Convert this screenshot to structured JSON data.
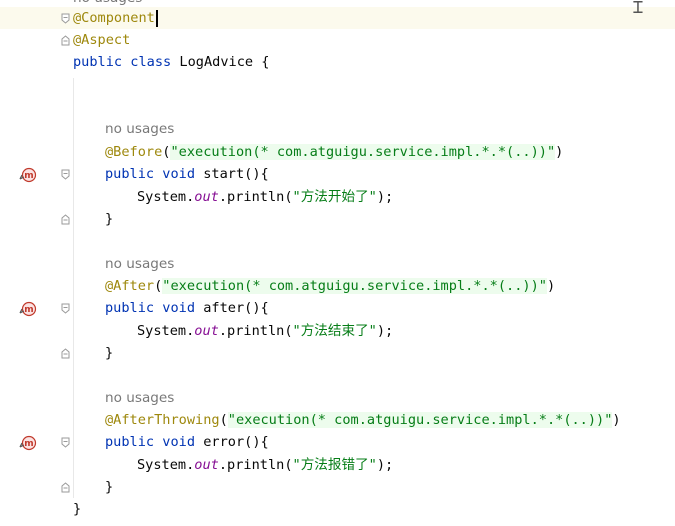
{
  "editor": {
    "top_hint": "no usages",
    "annotation_component": "@Component",
    "annotation_aspect": "@Aspect",
    "class_decl": {
      "keyword_public": "public",
      "keyword_class": "class",
      "name": "LogAdvice",
      "open_brace": " {"
    },
    "methods": [
      {
        "hint": "no usages",
        "annotation": "@Before",
        "pointcut": "\"execution(* com.atguigu.service.impl.*.*(..))\"",
        "signature_keywords": "public void",
        "signature_rest": " start(){",
        "body_prefix": "System.",
        "body_field": "out",
        "body_call": ".println(",
        "body_string": "\"方法开始了\"",
        "body_suffix": ");",
        "close_brace": "}",
        "gutter_icon": "method-override-icon"
      },
      {
        "hint": "no usages",
        "annotation": "@After",
        "pointcut": "\"execution(* com.atguigu.service.impl.*.*(..))\"",
        "signature_keywords": "public void",
        "signature_rest": " after(){",
        "body_prefix": "System.",
        "body_field": "out",
        "body_call": ".println(",
        "body_string": "\"方法结束了\"",
        "body_suffix": ");",
        "close_brace": "}",
        "gutter_icon": "method-override-icon"
      },
      {
        "hint": "no usages",
        "annotation": "@AfterThrowing",
        "pointcut": "\"execution(* com.atguigu.service.impl.*.*(..))\"",
        "signature_keywords": "public void",
        "signature_rest": " error(){",
        "body_prefix": "System.",
        "body_field": "out",
        "body_call": ".println(",
        "body_string": "\"方法报错了\"",
        "body_suffix": ");",
        "close_brace": "}",
        "gutter_icon": "method-override-icon"
      }
    ],
    "class_close": "}",
    "colors": {
      "annotation": "#9e880d",
      "keyword": "#0033b3",
      "string": "#067d17",
      "field": "#871094",
      "hint": "#787878",
      "current_line": "#fcfaed",
      "gutter_icon": "#c0392b"
    }
  }
}
